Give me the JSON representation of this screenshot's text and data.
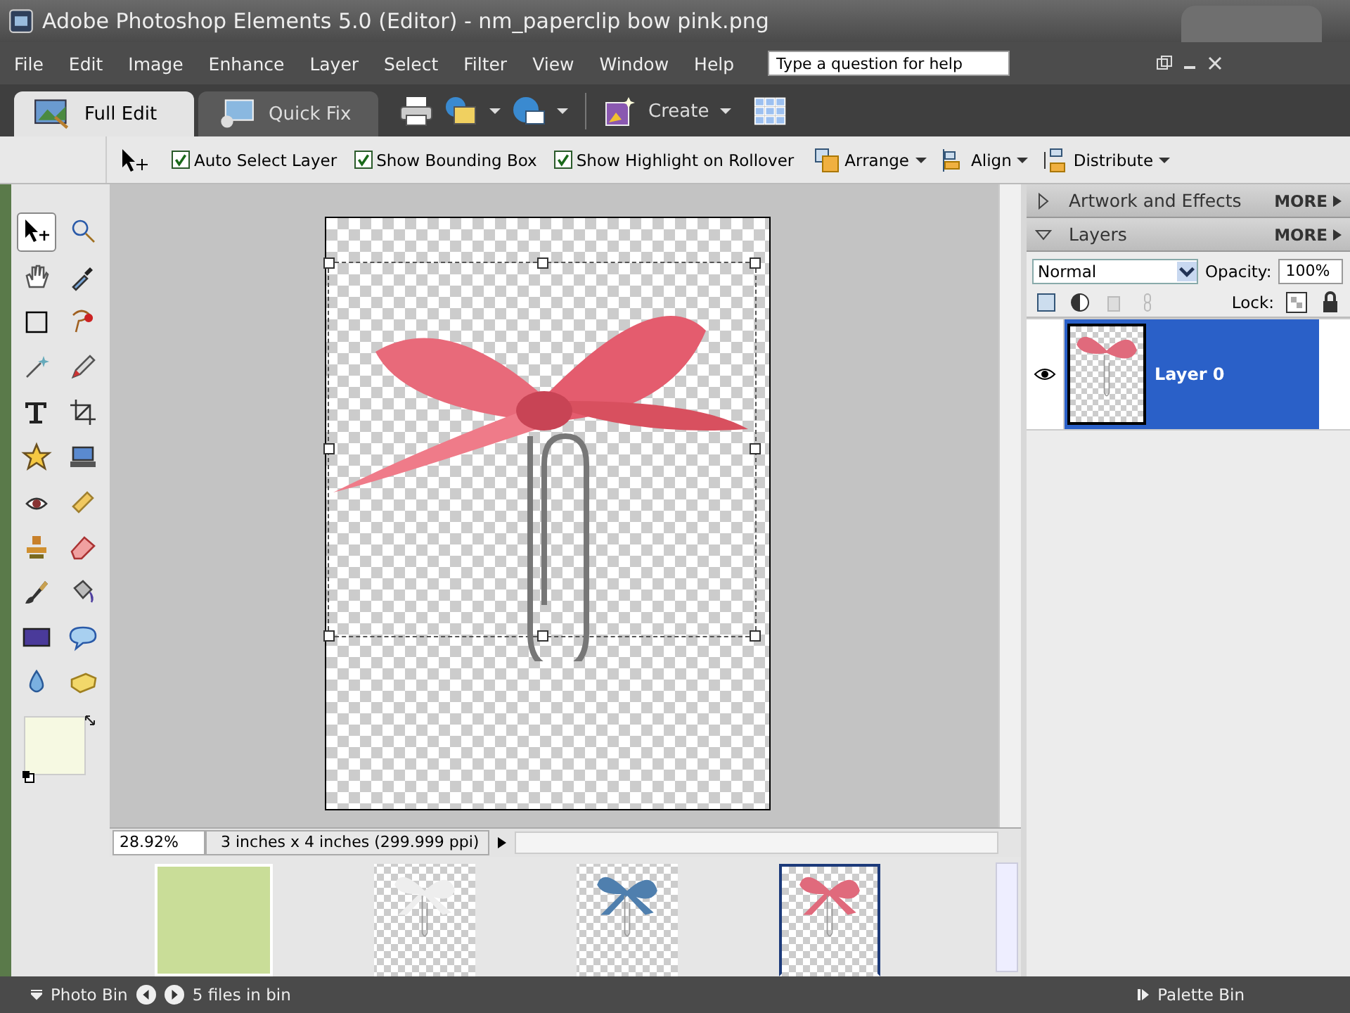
{
  "window": {
    "title": "Adobe Photoshop Elements 5.0 (Editor) - nm_paperclip bow pink.png"
  },
  "menu": [
    "File",
    "Edit",
    "Image",
    "Enhance",
    "Layer",
    "Select",
    "Filter",
    "View",
    "Window",
    "Help"
  ],
  "help_search": {
    "placeholder": "Type a question for help"
  },
  "tabs": [
    {
      "label": "Full Edit",
      "selected": true,
      "kind": "edit"
    },
    {
      "label": "Quick Fix",
      "selected": false,
      "kind": "fix"
    }
  ],
  "toolbar": {
    "create_label": "Create"
  },
  "options": {
    "checkboxes": [
      {
        "label": "Auto Select Layer",
        "checked": true
      },
      {
        "label": "Show Bounding Box",
        "checked": true
      },
      {
        "label": "Show Highlight on Rollover",
        "checked": true
      }
    ],
    "dropdowns": [
      {
        "label": "Arrange",
        "kind": "arrange"
      },
      {
        "label": "Align",
        "kind": "align"
      },
      {
        "label": "Distribute",
        "kind": "distribute"
      }
    ]
  },
  "tools": [
    {
      "kind": "move",
      "selected": true
    },
    {
      "kind": "zoom",
      "selected": false
    },
    {
      "kind": "hand",
      "selected": false
    },
    {
      "kind": "eyedropper",
      "selected": false
    },
    {
      "kind": "marquee",
      "selected": false
    },
    {
      "kind": "lasso",
      "selected": false
    },
    {
      "kind": "wand",
      "selected": false
    },
    {
      "kind": "pencil",
      "selected": false
    },
    {
      "kind": "text",
      "selected": false
    },
    {
      "kind": "crop",
      "selected": false
    },
    {
      "kind": "star",
      "selected": false
    },
    {
      "kind": "scanner",
      "selected": false
    },
    {
      "kind": "eye",
      "selected": false
    },
    {
      "kind": "bandage",
      "selected": false
    },
    {
      "kind": "stamp",
      "selected": false
    },
    {
      "kind": "eraser",
      "selected": false
    },
    {
      "kind": "brush",
      "selected": false
    },
    {
      "kind": "bucket",
      "selected": false
    },
    {
      "kind": "gradient",
      "selected": false
    },
    {
      "kind": "bubble",
      "selected": false
    },
    {
      "kind": "drop",
      "selected": false
    },
    {
      "kind": "sponge",
      "selected": false
    }
  ],
  "status": {
    "zoom": "28.92%",
    "document_info": "3 inches x 4 inches (299.999 ppi)"
  },
  "photo_bin": [
    {
      "kind": "paper",
      "color": "#c9dd98",
      "selected": false
    },
    {
      "kind": "bow",
      "color": "#eeeeee",
      "selected": false
    },
    {
      "kind": "bow",
      "color": "#4f7fae",
      "selected": false
    },
    {
      "kind": "bow",
      "color": "#e06a7c",
      "selected": true
    }
  ],
  "palettes": [
    {
      "title": "Artwork and Effects",
      "more": "MORE",
      "expanded": false
    },
    {
      "title": "Layers",
      "more": "MORE",
      "expanded": true
    }
  ],
  "layers_panel": {
    "blend_mode": "Normal",
    "opacity_label": "Opacity:",
    "opacity": "100%",
    "lock_label": "Lock:",
    "layers": [
      {
        "name": "Layer 0",
        "selected": true,
        "visible": true
      }
    ]
  },
  "bottom_bar": {
    "photo_bin": "Photo Bin",
    "files": "5 files in bin",
    "palette_bin": "Palette Bin"
  }
}
